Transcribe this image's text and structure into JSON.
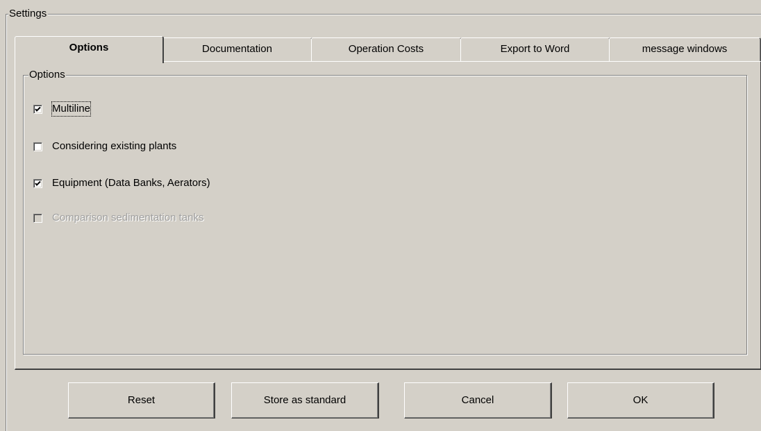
{
  "settings": {
    "title": "Settings"
  },
  "tabs": [
    {
      "label": "Options",
      "active": true
    },
    {
      "label": "Documentation",
      "active": false
    },
    {
      "label": "Operation Costs",
      "active": false
    },
    {
      "label": "Export to Word",
      "active": false
    },
    {
      "label": "message windows",
      "active": false
    }
  ],
  "options_group": {
    "title": "Options",
    "checkboxes": [
      {
        "label": "Multiline",
        "checked": true,
        "enabled": true
      },
      {
        "label": "Considering existing plants",
        "checked": false,
        "enabled": true
      },
      {
        "label": "Equipment (Data Banks, Aerators)",
        "checked": true,
        "enabled": true
      },
      {
        "label": "Comparison sedimentation tanks",
        "checked": false,
        "enabled": false
      }
    ]
  },
  "buttons": {
    "reset": "Reset",
    "store_standard": "Store as standard",
    "cancel": "Cancel",
    "ok": "OK"
  }
}
